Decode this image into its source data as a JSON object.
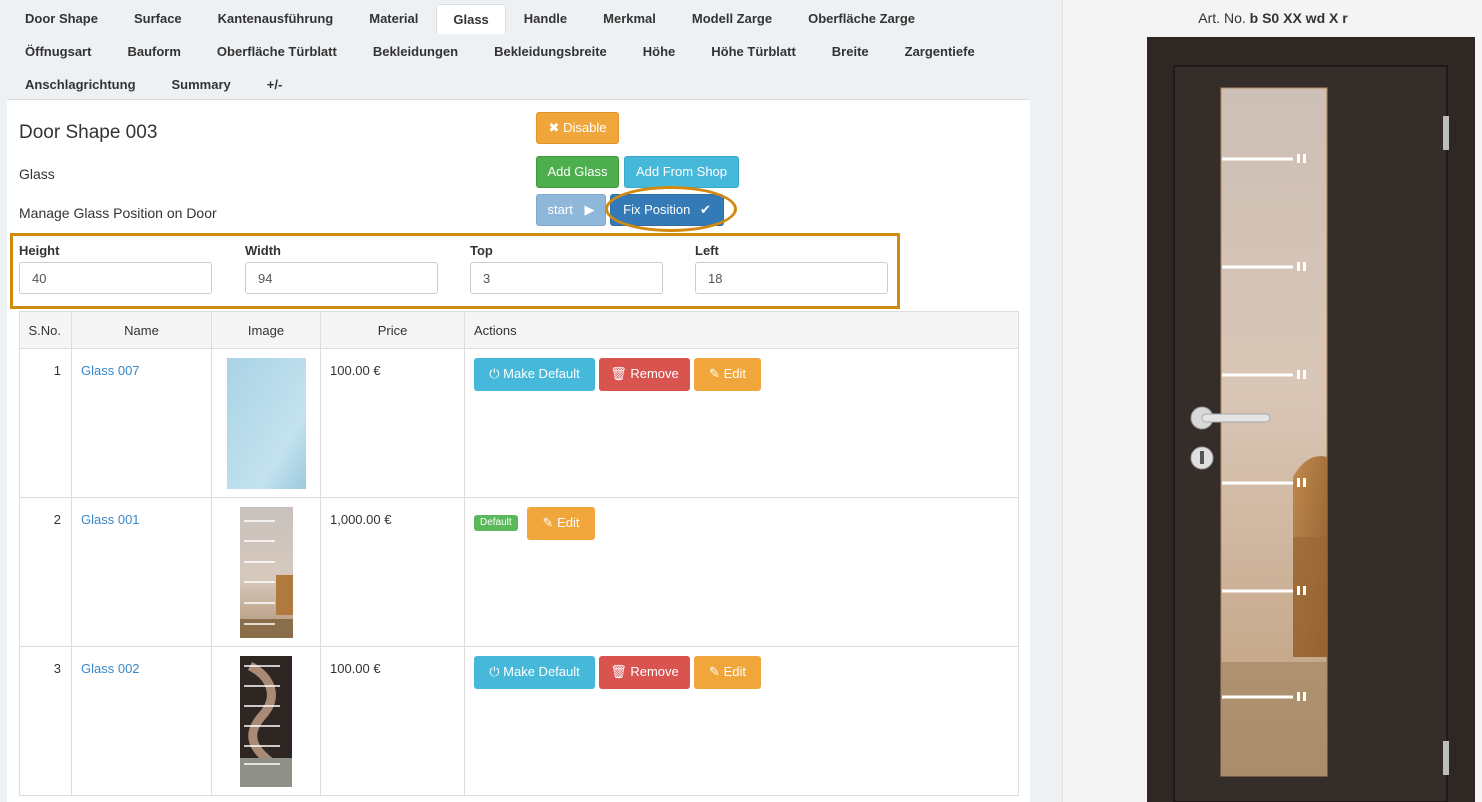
{
  "tabs": {
    "row1": [
      "Door Shape",
      "Surface",
      "Kantenausführung",
      "Material",
      "Glass",
      "Handle",
      "Merkmal",
      "Modell Zarge",
      "Oberfläche Zarge"
    ],
    "row2": [
      "Öffnugsart",
      "Bauform",
      "Oberfläche Türblatt",
      "Bekleidungen",
      "Bekleidungsbreite",
      "Höhe",
      "Höhe Türblatt",
      "Breite",
      "Zargentiefe"
    ],
    "row3": [
      "Anschlagrichtung",
      "Summary",
      "+/-"
    ],
    "active": "Glass"
  },
  "page": {
    "title": "Door Shape 003",
    "subtitle": "Glass",
    "section": "Manage Glass Position on Door"
  },
  "buttons": {
    "disable": "Disable",
    "add_glass": "Add Glass",
    "add_from_shop": "Add From Shop",
    "start": "start",
    "fix_position": "Fix Position"
  },
  "position": {
    "height_label": "Height",
    "height_value": "40",
    "width_label": "Width",
    "width_value": "94",
    "top_label": "Top",
    "top_value": "3",
    "left_label": "Left",
    "left_value": "18"
  },
  "table": {
    "headers": [
      "S.No.",
      "Name",
      "Image",
      "Price",
      "Actions"
    ],
    "rows": [
      {
        "sno": "1",
        "name": "Glass 007",
        "price": "100.00 €",
        "is_default": false
      },
      {
        "sno": "2",
        "name": "Glass 001",
        "price": "1,000.00 €",
        "is_default": true
      },
      {
        "sno": "3",
        "name": "Glass 002",
        "price": "100.00 €",
        "is_default": false
      }
    ],
    "make_default_label": "Make Default",
    "remove_label": "Remove",
    "edit_label": "Edit",
    "default_badge": "Default"
  },
  "preview": {
    "art_prefix": "Art. No.",
    "art_code": "b S0 XX wd X r"
  },
  "colors": {
    "warning": "#f0a63a",
    "success": "#4cae4c",
    "info": "#46b8da",
    "primary": "#337ab7",
    "danger": "#d9534f",
    "highlight": "#d18a10",
    "door": "#2f2825"
  }
}
